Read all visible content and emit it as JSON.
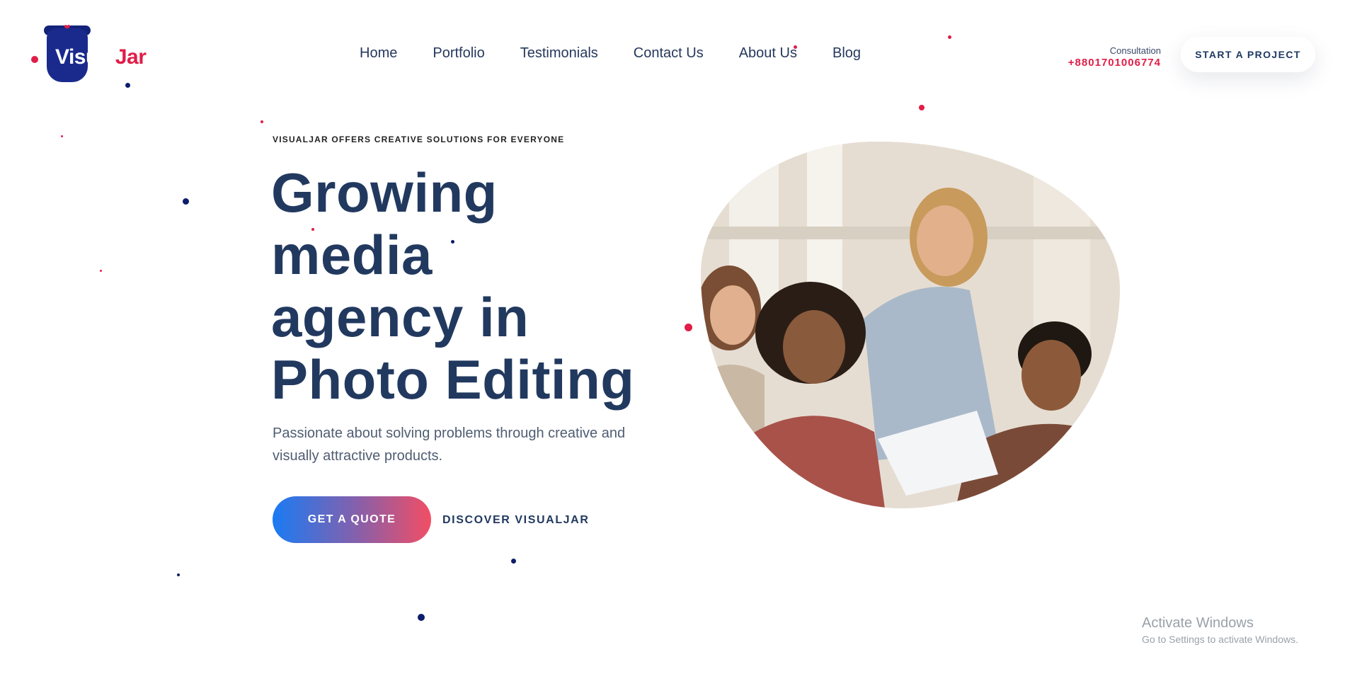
{
  "header": {
    "logo": {
      "text_part1": "Visual",
      "text_part2": "Jar",
      "icon": "jar-logo-icon"
    },
    "nav": [
      {
        "label": "Home"
      },
      {
        "label": "Portfolio"
      },
      {
        "label": "Testimonials"
      },
      {
        "label": "Contact Us"
      },
      {
        "label": "About Us"
      },
      {
        "label": "Blog"
      }
    ],
    "consultation_label": "Consultation",
    "phone": "+8801701006774",
    "cta_label": "START A PROJECT"
  },
  "hero": {
    "eyebrow": "VISUALJAR OFFERS CREATIVE SOLUTIONS FOR EVERYONE",
    "headline_lines": [
      "Growing",
      "media",
      "agency in",
      "Photo Editing"
    ],
    "lead": "Passionate about solving problems through creative and visually attractive products.",
    "primary_button": "GET A QUOTE",
    "secondary_link": "DISCOVER VISUALJAR"
  },
  "watermark": {
    "title": "Activate Windows",
    "subtitle": "Go to Settings to activate Windows."
  },
  "colors": {
    "navy_text": "#22395f",
    "accent_red": "#e11d48",
    "gradient_start": "#1a7bf4",
    "gradient_end": "#f24e64",
    "dot_navy": "#0c1d6b"
  }
}
